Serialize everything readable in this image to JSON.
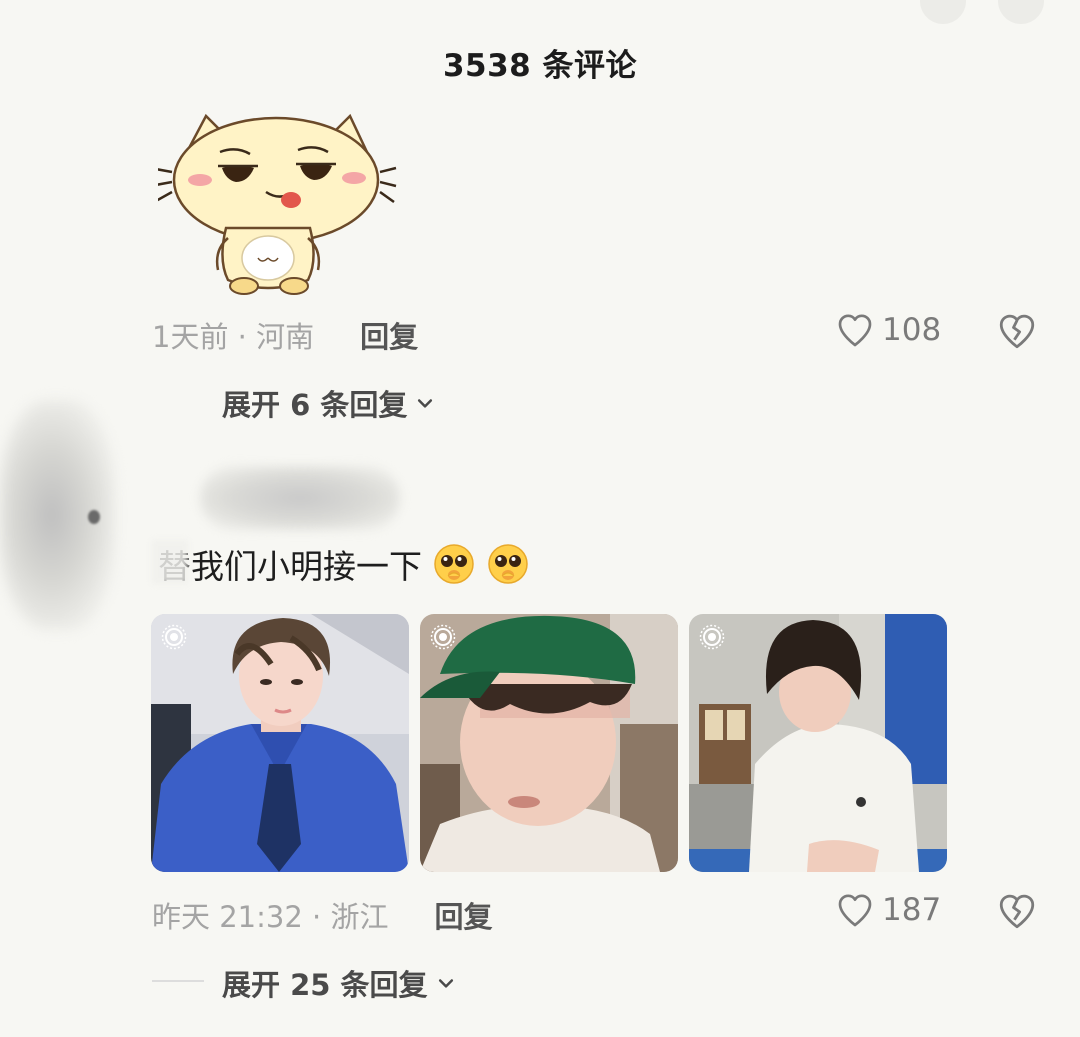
{
  "header": {
    "title": "3538 条评论"
  },
  "comment1": {
    "meta": "1天前 · 河南",
    "reply_label": "回复",
    "likes": "108",
    "expand_label": "展开 6 条回复"
  },
  "comment2": {
    "text": "替我们小明接一下",
    "meta": "昨天 21:32 · 浙江",
    "reply_label": "回复",
    "likes": "187",
    "expand_label": "展开 25 条回复",
    "photos": [
      {
        "subject": "person-blue-shirt"
      },
      {
        "subject": "person-green-cap"
      },
      {
        "subject": "person-white-tshirt"
      }
    ]
  },
  "icons": {
    "like": "heart-icon",
    "dislike": "broken-heart-icon",
    "expand": "chevron-down-icon",
    "live": "live-photo-icon"
  },
  "colors": {
    "background": "#f7f7f3",
    "meta_text": "#9b9b9b",
    "blue_shirt": "#3b5fc7",
    "green_cap": "#1f6b44"
  }
}
